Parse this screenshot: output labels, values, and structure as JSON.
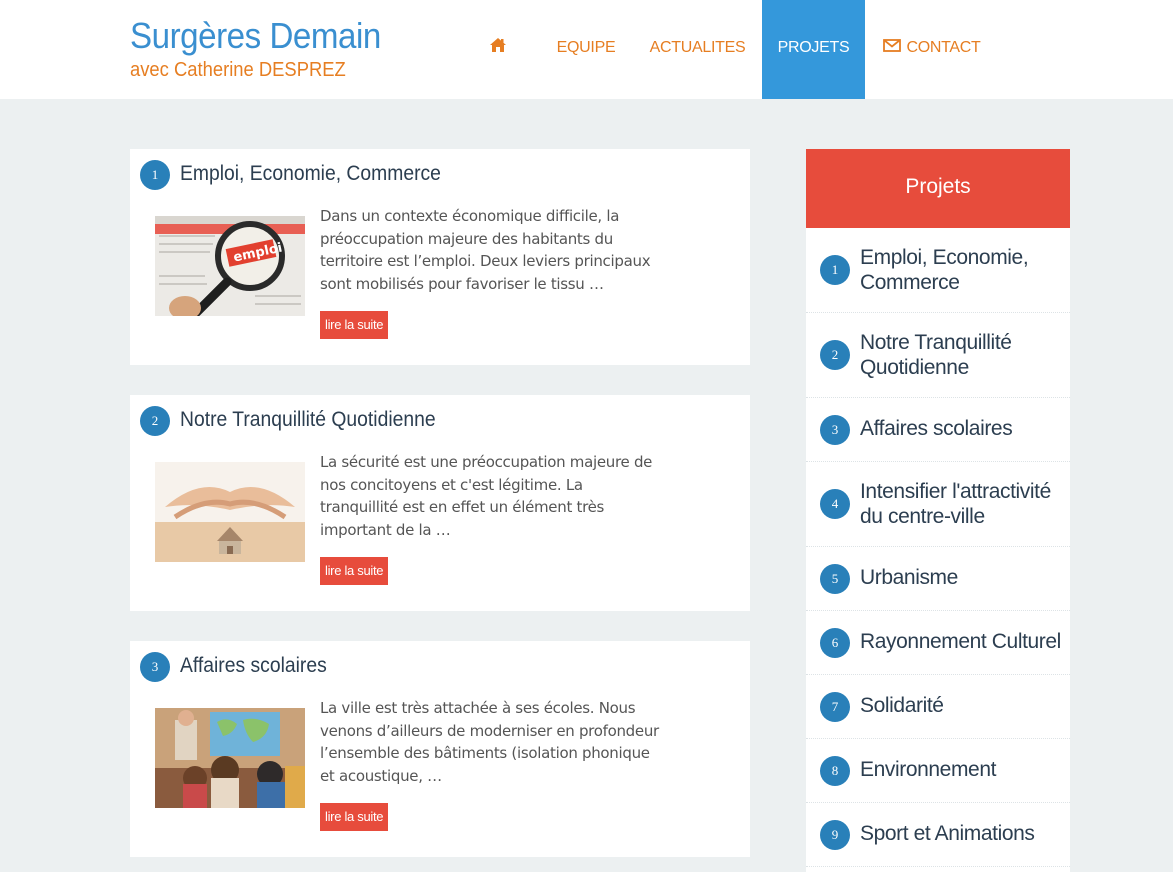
{
  "header": {
    "site_title": "Surgères Demain",
    "site_subtitle": "avec Catherine DESPREZ"
  },
  "nav": {
    "home_icon": "home-icon",
    "items": [
      {
        "label": "EQUIPE"
      },
      {
        "label": "ACTUALITES"
      },
      {
        "label": "PROJETS",
        "active": true
      },
      {
        "label": "CONTACT",
        "icon": "mail-icon"
      }
    ]
  },
  "articles": [
    {
      "number": "1",
      "title": "Emploi, Economie, Commerce",
      "excerpt": "Dans un contexte économique difficile, la préoccupation majeure des habitants du territoire est l’emploi. Deux leviers principaux sont mobilisés pour favoriser le tissu …",
      "more": "lire la suite",
      "image_label": "emploi"
    },
    {
      "number": "2",
      "title": "Notre Tranquillité Quotidienne",
      "excerpt": "La sécurité est une préoccupation majeure de nos concitoyens et c'est légitime. La tranquillité est en effet un élément très important de la …",
      "more": "lire la suite"
    },
    {
      "number": "3",
      "title": "Affaires scolaires",
      "excerpt": "La ville est très attachée à ses écoles. Nous venons d’ailleurs de moderniser en profondeur l’ensemble des bâtiments (isolation phonique et acoustique, …",
      "more": "lire la suite"
    }
  ],
  "sidebar": {
    "title": "Projets",
    "items": [
      {
        "number": "1",
        "label": "Emploi, Economie, Commerce"
      },
      {
        "number": "2",
        "label": "Notre Tranquillité Quotidienne"
      },
      {
        "number": "3",
        "label": "Affaires scolaires"
      },
      {
        "number": "4",
        "label": "Intensifier l'attractivité du centre-ville"
      },
      {
        "number": "5",
        "label": "Urbanisme"
      },
      {
        "number": "6",
        "label": "Rayonnement Culturel"
      },
      {
        "number": "7",
        "label": "Solidarité"
      },
      {
        "number": "8",
        "label": "Environnement"
      },
      {
        "number": "9",
        "label": "Sport et Animations"
      }
    ]
  },
  "colors": {
    "accent_blue": "#3498db",
    "accent_orange": "#e67e22",
    "accent_red": "#e74c3c",
    "badge_blue": "#2980b9"
  }
}
